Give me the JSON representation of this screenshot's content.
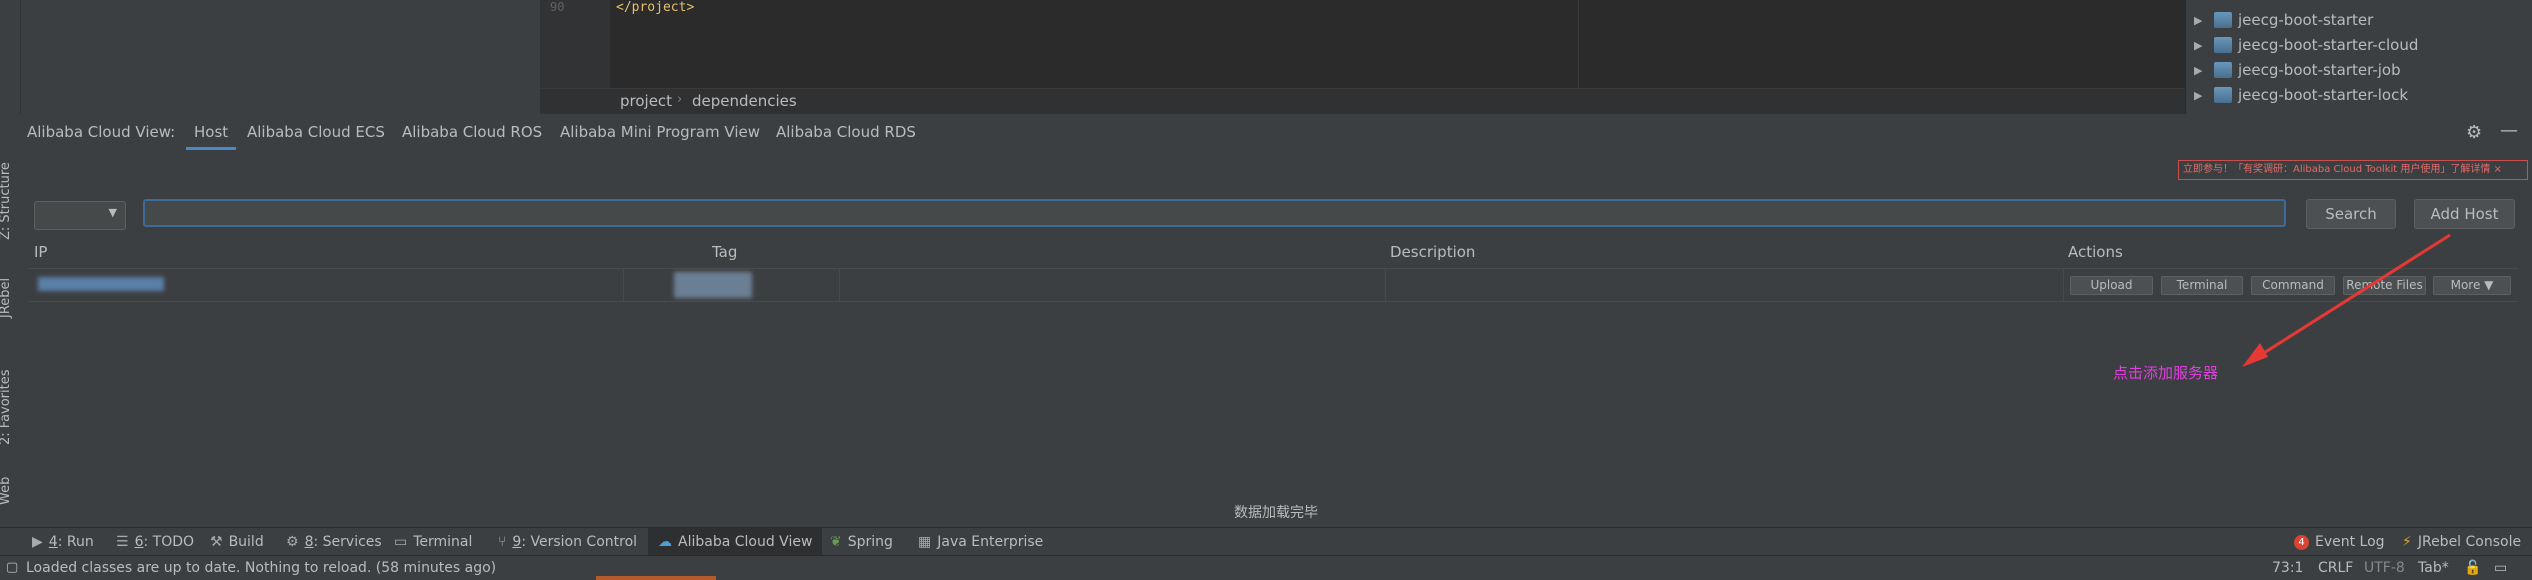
{
  "editor": {
    "line_number": "90",
    "code": "</project>",
    "breadcrumb": [
      "project",
      "dependencies"
    ],
    "breadcrumb_separator": "›"
  },
  "project_tree": {
    "items": [
      {
        "label": "jeecg-boot-starter"
      },
      {
        "label": "jeecg-boot-starter-cloud"
      },
      {
        "label": "jeecg-boot-starter-job"
      },
      {
        "label": "jeecg-boot-starter-lock"
      }
    ]
  },
  "left_stripe": {
    "structure": "Z: Structure",
    "jrebel": "JRebel",
    "favorites": "2: Favorites",
    "web": "Web"
  },
  "tool_window": {
    "title": "Alibaba Cloud View:",
    "tabs": [
      {
        "label": "Host",
        "active": true
      },
      {
        "label": "Alibaba Cloud ECS"
      },
      {
        "label": "Alibaba Cloud ROS"
      },
      {
        "label": "Alibaba Mini Program View"
      },
      {
        "label": "Alibaba Cloud RDS"
      }
    ],
    "notice": "立即参与！「有奖调研：Alibaba Cloud Toolkit 用户使用」了解详情 ×",
    "search_input_value": "",
    "search_button": "Search",
    "add_host_button": "Add Host",
    "table": {
      "columns": [
        "IP",
        "Tag",
        "Description",
        "Actions"
      ],
      "row_actions": [
        "Upload",
        "Terminal",
        "Command",
        "Remote Files",
        "More ▼"
      ]
    },
    "annotation": "点击添加服务器",
    "status_message": "数据加载完毕"
  },
  "bottom_tools": [
    {
      "key": "4",
      "label": ": Run",
      "icon": "run-icon"
    },
    {
      "key": "6",
      "label": ": TODO",
      "icon": "list-icon"
    },
    {
      "key": "",
      "label": "Build",
      "icon": "hammer-icon"
    },
    {
      "key": "8",
      "label": ": Services",
      "icon": "services-icon"
    },
    {
      "key": "",
      "label": "Terminal",
      "icon": "terminal-icon"
    },
    {
      "key": "9",
      "label": ": Version Control",
      "icon": "vcs-icon"
    },
    {
      "key": "",
      "label": "Alibaba Cloud View",
      "icon": "cloud-icon",
      "active": true
    },
    {
      "key": "",
      "label": "Spring",
      "icon": "spring-icon"
    },
    {
      "key": "",
      "label": "Java Enterprise",
      "icon": "javaee-icon"
    }
  ],
  "right_tools": {
    "event_log_count": "4",
    "event_log": "Event Log",
    "jrebel_console": "JRebel Console"
  },
  "status_bar": {
    "message": "Loaded classes are up to date. Nothing to reload. (58 minutes ago)",
    "position": "73:1",
    "line_sep": "CRLF",
    "encoding": "UTF-8",
    "indent": "Tab*"
  },
  "colors": {
    "background": "#3c3f41",
    "editor": "#2b2b2b",
    "accent": "#4a88c7",
    "annotation": "#e040e0",
    "arrow": "#e53935"
  }
}
